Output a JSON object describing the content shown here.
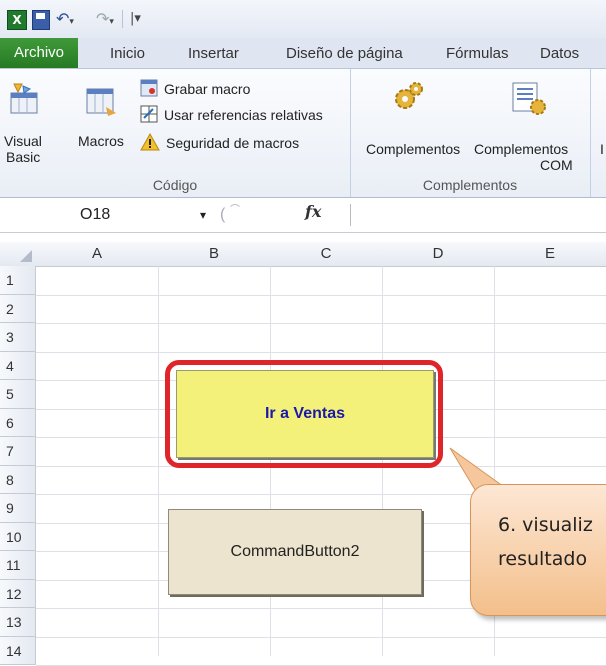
{
  "quick_access": {
    "file_icon": "excel-icon",
    "save_icon": "save-icon",
    "undo_icon": "undo-icon",
    "redo_icon": "redo-icon",
    "customize_icon": "customize-qat-icon"
  },
  "tabs": [
    "Archivo",
    "Inicio",
    "Insertar",
    "Diseño de página",
    "Fórmulas",
    "Datos"
  ],
  "ribbon": {
    "codigo": {
      "label": "Código",
      "visual_basic": [
        "Visual",
        "Basic"
      ],
      "macros": "Macros",
      "grabar": "Grabar macro",
      "usar_ref": "Usar referencias relativas",
      "seguridad": "Seguridad de macros"
    },
    "complementos": {
      "label": "Complementos",
      "complementos": "Complementos",
      "com": [
        "Complementos",
        "COM"
      ]
    }
  },
  "formula_bar": {
    "name_box": "O18",
    "fx": "fx"
  },
  "columns": [
    "A",
    "B",
    "C",
    "D",
    "E"
  ],
  "rows": [
    "1",
    "2",
    "3",
    "4",
    "5",
    "6",
    "7",
    "8",
    "9",
    "10",
    "11",
    "12",
    "13",
    "14"
  ],
  "buttons": {
    "ventas": "Ir a Ventas",
    "cmd2": "CommandButton2"
  },
  "callout": {
    "text": "6. visualiz\nresultado"
  }
}
